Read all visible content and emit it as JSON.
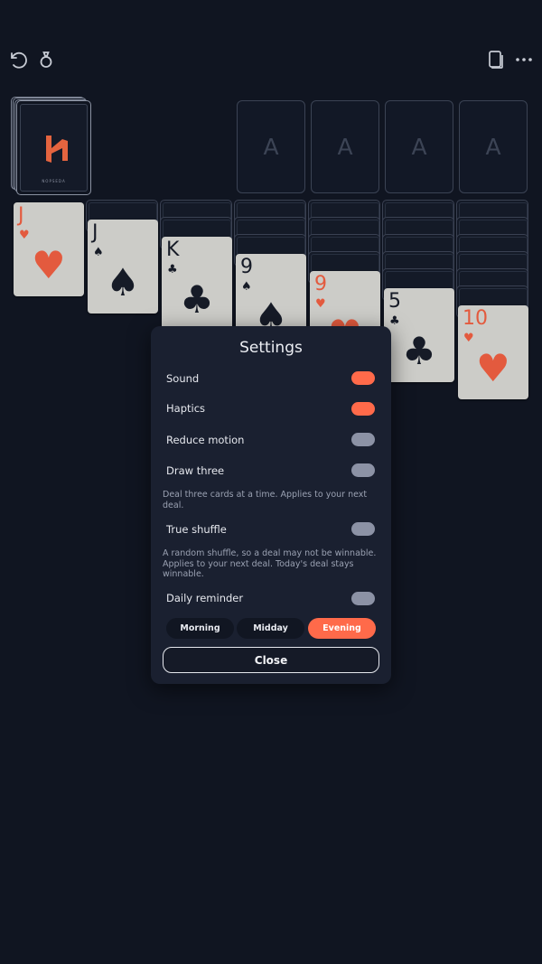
{
  "toolbar": {
    "undo_icon": "undo-icon",
    "hint_icon": "hint-icon",
    "cards_icon": "cards-icon",
    "more_icon": "more-icon"
  },
  "stock": {
    "brand": "NOPSEDA",
    "logo_color": "#e4643f"
  },
  "foundations": [
    {
      "label": "A"
    },
    {
      "label": "A"
    },
    {
      "label": "A"
    },
    {
      "label": "A"
    }
  ],
  "tableau": [
    {
      "rank": "J",
      "suit": "♥",
      "color": "red"
    },
    {
      "rank": "J",
      "suit": "♠",
      "color": "black"
    },
    {
      "rank": "K",
      "suit": "♣",
      "color": "black"
    },
    {
      "rank": "9",
      "suit": "♠",
      "color": "black"
    },
    {
      "rank": "9",
      "suit": "♥",
      "color": "red"
    },
    {
      "rank": "5",
      "suit": "♣",
      "color": "black"
    },
    {
      "rank": "10",
      "suit": "♥",
      "color": "red"
    }
  ],
  "settings": {
    "title": "Settings",
    "sound": {
      "label": "Sound",
      "on": true
    },
    "haptics": {
      "label": "Haptics",
      "on": true
    },
    "reduce_motion": {
      "label": "Reduce motion",
      "on": false
    },
    "draw_three": {
      "label": "Draw three",
      "on": false,
      "description": "Deal three cards at a time. Applies to your next deal."
    },
    "true_shuffle": {
      "label": "True shuffle",
      "on": false,
      "description": "A random shuffle, so a deal may not be winnable. Applies to your next deal. Today's deal stays winnable."
    },
    "daily_reminder": {
      "label": "Daily reminder",
      "on": false
    },
    "reminder_times": [
      "Morning",
      "Midday",
      "Evening"
    ],
    "selected_time": "Evening",
    "close_label": "Close"
  },
  "colors": {
    "background": "#101521",
    "accent": "#ff6a4a",
    "red_suit": "#e35a3e",
    "black_suit": "#161b27",
    "card_face": "#ccccc8"
  }
}
